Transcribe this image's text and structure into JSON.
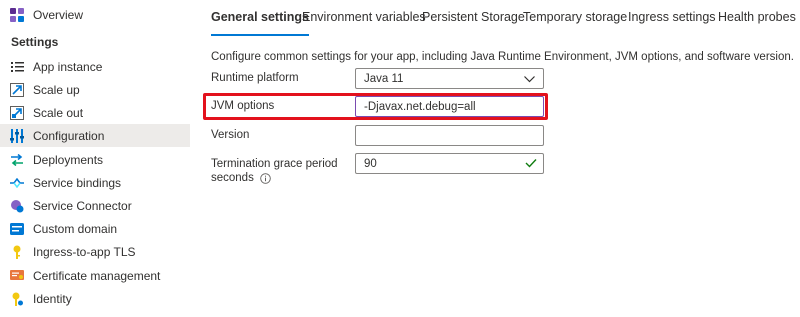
{
  "sidebar": {
    "overview": "Overview",
    "section_title": "Settings",
    "items": [
      {
        "label": "App instance",
        "icon": "list-icon"
      },
      {
        "label": "Scale up",
        "icon": "scale-up-icon"
      },
      {
        "label": "Scale out",
        "icon": "scale-out-icon"
      },
      {
        "label": "Configuration",
        "icon": "configuration-icon",
        "selected": true
      },
      {
        "label": "Deployments",
        "icon": "deployments-icon"
      },
      {
        "label": "Service bindings",
        "icon": "service-bindings-icon"
      },
      {
        "label": "Service Connector",
        "icon": "service-connector-icon"
      },
      {
        "label": "Custom domain",
        "icon": "custom-domain-icon"
      },
      {
        "label": "Ingress-to-app TLS",
        "icon": "key-icon"
      },
      {
        "label": "Certificate management",
        "icon": "certificate-icon"
      },
      {
        "label": "Identity",
        "icon": "identity-icon"
      }
    ]
  },
  "tabs": [
    {
      "label": "General settings",
      "active": true
    },
    {
      "label": "Environment variables"
    },
    {
      "label": "Persistent Storage"
    },
    {
      "label": "Temporary storage"
    },
    {
      "label": "Ingress settings"
    },
    {
      "label": "Health probes"
    }
  ],
  "form": {
    "description": "Configure common settings for your app, including Java Runtime Environment, JVM options, and software version.",
    "runtime_label": "Runtime platform",
    "runtime_value": "Java 11",
    "jvm_label": "JVM options",
    "jvm_value": "-Djavax.net.debug=all",
    "version_label": "Version",
    "version_value": "",
    "termination_label_1": "Termination grace period",
    "termination_label_2": "seconds",
    "termination_value": "90"
  },
  "colors": {
    "accent": "#0078d4",
    "highlight_box": "#e3111d",
    "selected_bg": "#edebe9",
    "valid_check": "#107c10"
  }
}
